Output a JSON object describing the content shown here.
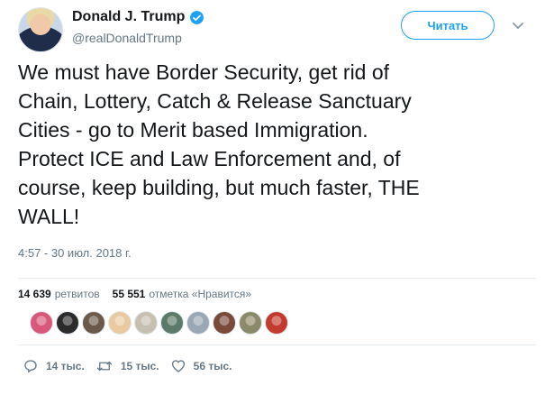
{
  "header": {
    "name": "Donald J. Trump",
    "handle": "@realDonaldTrump",
    "follow_label": "Читать",
    "verified_icon": "verified-badge-icon",
    "menu_icon": "chevron-down-icon"
  },
  "tweet": {
    "text": "We must have Border Security, get rid of\nChain, Lottery, Catch & Release Sanctuary\nCities - go to Merit based Immigration.\nProtect ICE and Law Enforcement and, of\ncourse, keep building, but much faster, THE\nWALL!",
    "timestamp": "4:57 - 30 июл. 2018 г."
  },
  "stats": {
    "retweets_count": "14 639",
    "retweets_label": "ретвитов",
    "likes_count": "55 551",
    "likes_label": "отметка «Нравится»"
  },
  "liker_faces": [
    {
      "color": "#d9577a"
    },
    {
      "color": "#2b2b2b"
    },
    {
      "color": "#6b5a4a"
    },
    {
      "color": "#e8c9a0"
    },
    {
      "color": "#c7c0b0"
    },
    {
      "color": "#5c7a6a"
    },
    {
      "color": "#9aa7b4"
    },
    {
      "color": "#7a4a3a"
    },
    {
      "color": "#8a8a6a"
    },
    {
      "color": "#c23b2e"
    }
  ],
  "actions": {
    "reply_count": "14 тыс.",
    "retweet_count": "15 тыс.",
    "like_count": "56 тыс."
  },
  "colors": {
    "accent": "#1da1f2",
    "text": "#14171a",
    "secondary": "#657786"
  }
}
